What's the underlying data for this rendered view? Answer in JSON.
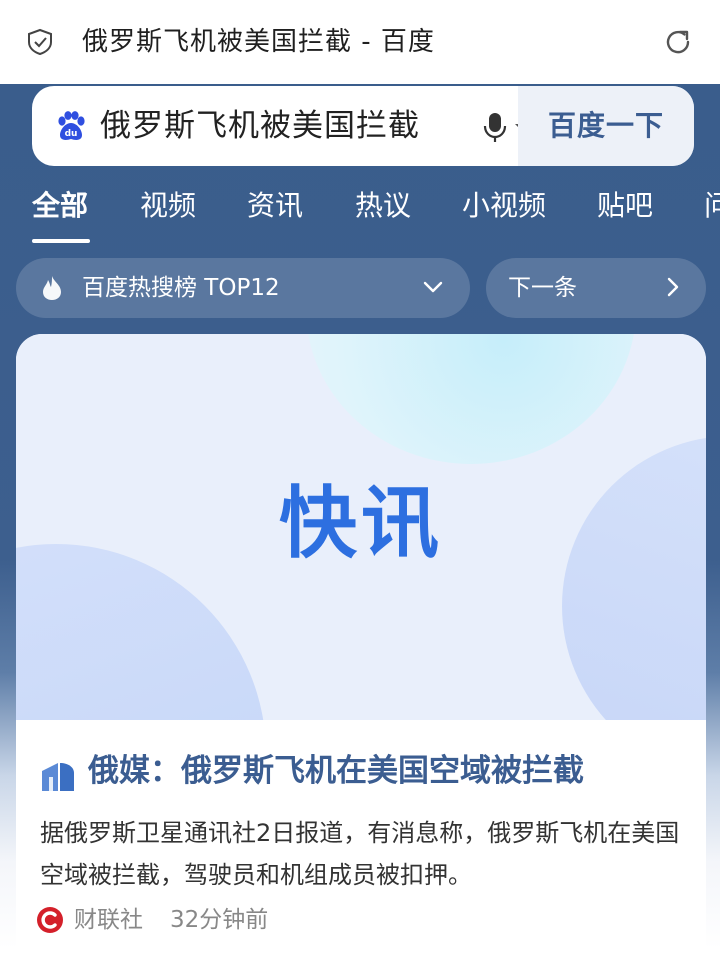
{
  "browser": {
    "page_title": "俄罗斯飞机被美国拦截 - 百度",
    "icons": {
      "security": "shield-check-icon",
      "reload": "refresh-icon"
    }
  },
  "search": {
    "query": "俄罗斯飞机被美国拦截",
    "button_label": "百度一下",
    "icons": {
      "logo": "baidu-paw-icon",
      "voice": "microphone-icon"
    }
  },
  "tabs": [
    {
      "label": "全部",
      "active": true
    },
    {
      "label": "视频",
      "active": false
    },
    {
      "label": "资讯",
      "active": false
    },
    {
      "label": "热议",
      "active": false
    },
    {
      "label": "小视频",
      "active": false
    },
    {
      "label": "贴吧",
      "active": false
    },
    {
      "label": "问",
      "active": false
    }
  ],
  "hot_list": {
    "label": "百度热搜榜 TOP12",
    "next_label": "下一条"
  },
  "news_card": {
    "banner_text": "快讯",
    "title": "俄媒：俄罗斯飞机在美国空域被拦截",
    "description": "据俄罗斯卫星通讯社2日报道，有消息称，俄罗斯飞机在美国空域被拦截，驾驶员和机组成员被扣押。",
    "source": "财联社",
    "time": "32分钟前"
  },
  "colors": {
    "header_bg": "#3a5d8c",
    "accent_blue": "#3b5d91",
    "banner_text": "#2d6fe0",
    "source_logo": "#d4202a"
  }
}
